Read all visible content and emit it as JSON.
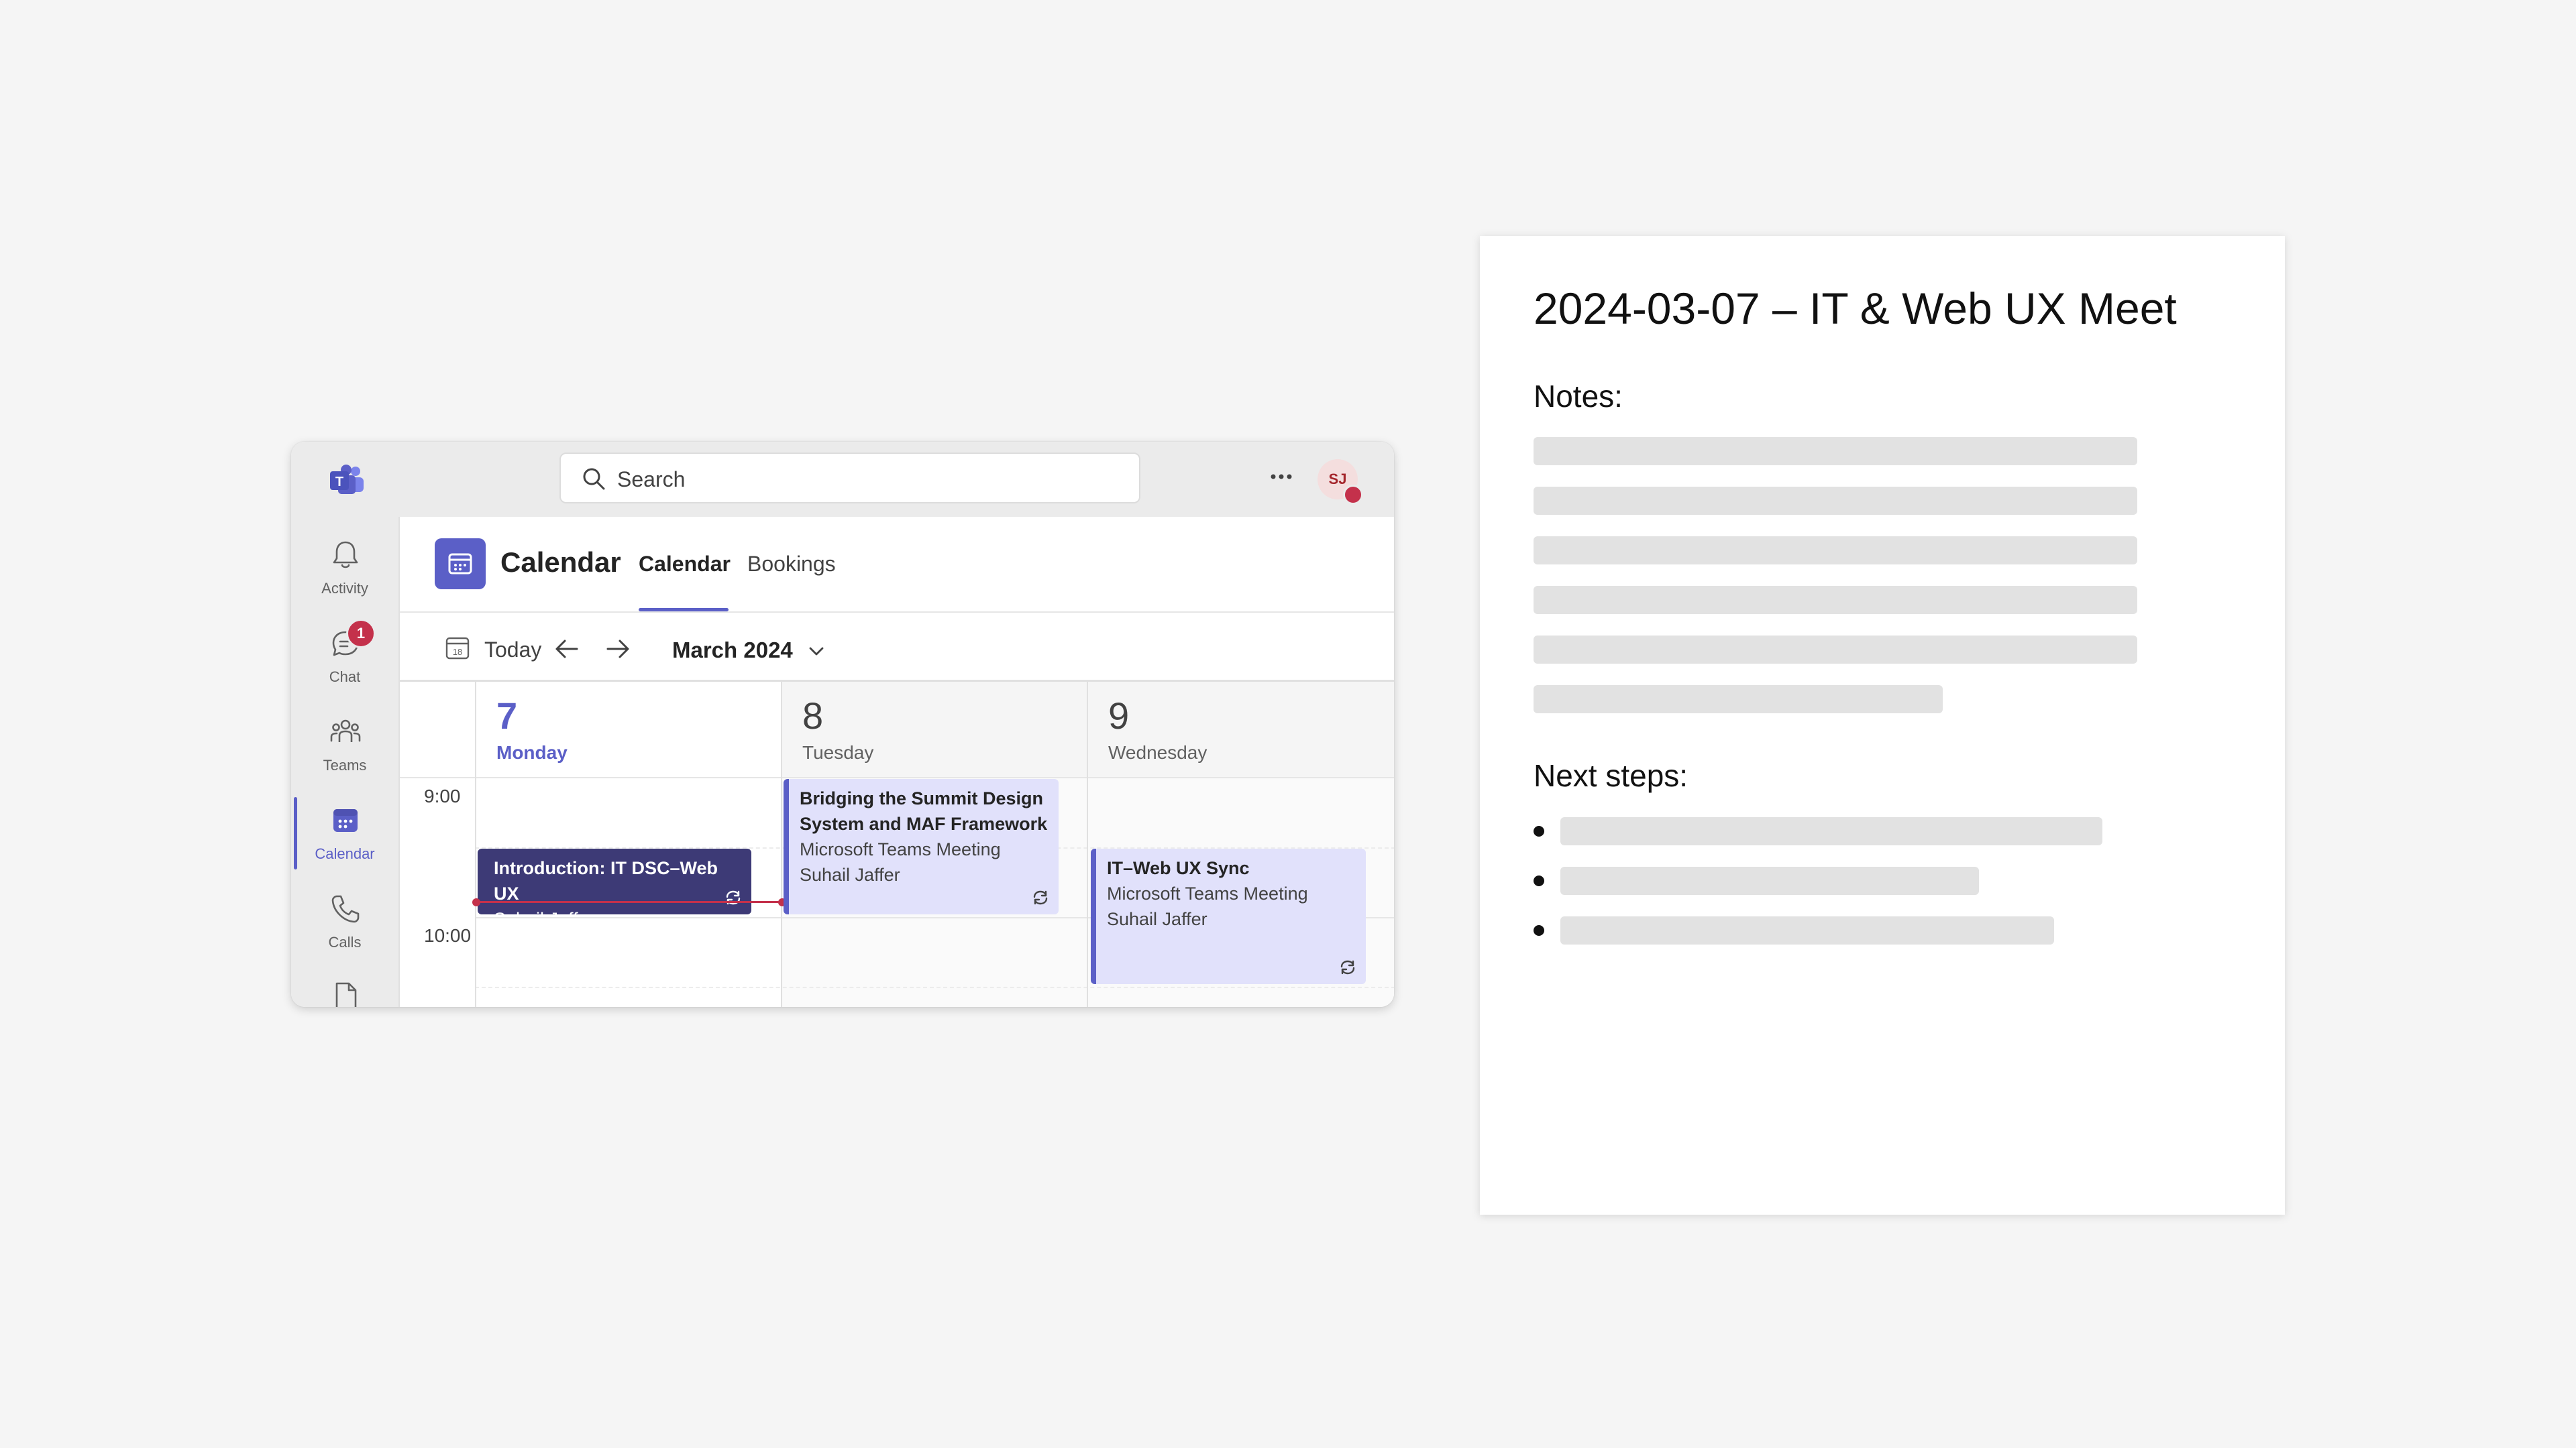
{
  "titlebar": {
    "search_placeholder": "Search",
    "avatar_initials": "SJ"
  },
  "rail": {
    "items": [
      {
        "label": "Activity",
        "icon": "bell-icon"
      },
      {
        "label": "Chat",
        "icon": "chat-icon",
        "badge": "1"
      },
      {
        "label": "Teams",
        "icon": "people-icon"
      },
      {
        "label": "Calendar",
        "icon": "calendar-icon",
        "active": true
      },
      {
        "label": "Calls",
        "icon": "phone-icon"
      },
      {
        "label": "",
        "icon": "file-icon"
      }
    ]
  },
  "app": {
    "title": "Calendar",
    "tabs": [
      {
        "label": "Calendar",
        "active": true
      },
      {
        "label": "Bookings",
        "active": false
      }
    ]
  },
  "toolbar": {
    "today_icon_num": "18",
    "today_label": "Today",
    "month_label": "March 2024"
  },
  "calendar": {
    "days": [
      {
        "num": "7",
        "name": "Monday",
        "today": true
      },
      {
        "num": "8",
        "name": "Tuesday",
        "today": false
      },
      {
        "num": "9",
        "name": "Wednesday",
        "today": false
      }
    ],
    "times": [
      "9:00",
      "10:00"
    ],
    "events": [
      {
        "day": 0,
        "title": "Introduction: IT DSC–Web UX",
        "lines": [
          "Suhail Jaffer"
        ],
        "style": "dark",
        "recurring": true
      },
      {
        "day": 1,
        "title": "Bridging the Summit Design System and MAF Framework",
        "lines": [
          "Microsoft Teams Meeting",
          "Suhail Jaffer"
        ],
        "style": "light",
        "recurring": true
      },
      {
        "day": 2,
        "title": "IT–Web UX Sync",
        "lines": [
          "Microsoft Teams Meeting",
          "Suhail Jaffer"
        ],
        "style": "light",
        "recurring": true
      }
    ]
  },
  "notes": {
    "title": "2024-03-07 – IT & Web UX Meet",
    "notes_label": "Notes:",
    "next_steps_label": "Next steps:",
    "note_placeholder_lines": 6,
    "next_step_placeholder_items": 3
  },
  "colors": {
    "accent": "#5b5fc7",
    "dark_event": "#3d3a76",
    "light_event": "#e1e1fb",
    "alert": "#c4314b"
  }
}
